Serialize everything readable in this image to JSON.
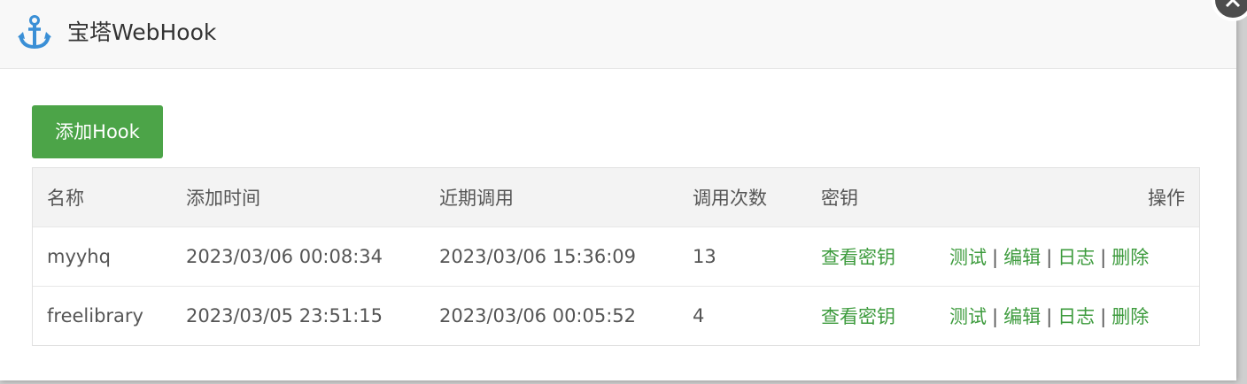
{
  "dialog": {
    "title": "宝塔WebHook",
    "icon": "anchor-icon"
  },
  "toolbar": {
    "add_label": "添加Hook"
  },
  "table": {
    "headers": [
      "名称",
      "添加时间",
      "近期调用",
      "调用次数",
      "密钥",
      "操作"
    ],
    "rows": [
      {
        "name": "myyhq",
        "added": "2023/03/06 00:08:34",
        "recent": "2023/03/06 15:36:09",
        "count": "13",
        "key_link": "查看密钥",
        "actions": [
          "测试",
          "编辑",
          "日志",
          "删除"
        ]
      },
      {
        "name": "freelibrary",
        "added": "2023/03/05 23:51:15",
        "recent": "2023/03/06 00:05:52",
        "count": "4",
        "key_link": "查看密钥",
        "actions": [
          "测试",
          "编辑",
          "日志",
          "删除"
        ]
      }
    ],
    "separator": "|"
  },
  "colors": {
    "accent_green": "#4ca448",
    "link_green": "#3d9b3d",
    "icon_blue": "#3a8fd6"
  }
}
